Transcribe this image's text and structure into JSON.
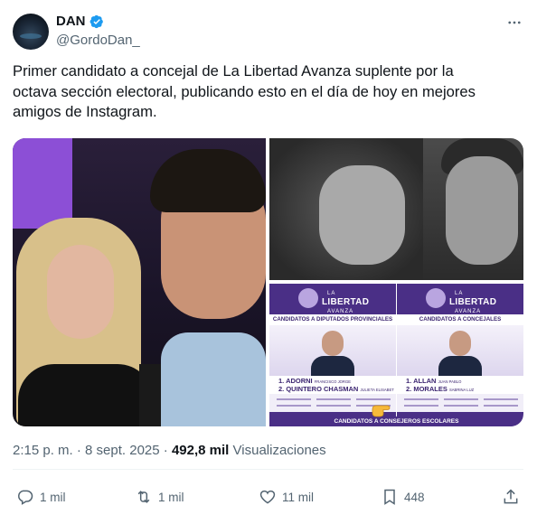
{
  "author": {
    "display_name": "DAN",
    "handle": "@GordoDan_",
    "verified": true
  },
  "tweet": {
    "text_lines": [
      "Primer candidato a concejal de La Libertad Avanza suplente por la",
      "octava sección electoral, publicando esto en el día de hoy en mejores",
      "amigos de Instagram."
    ]
  },
  "flyer": {
    "brand_line1": "LA",
    "brand_line2": "LIBERTAD",
    "brand_line3": "AVANZA",
    "left_title": "CANDIDATOS A DIPUTADOS PROVINCIALES",
    "right_title": "CANDIDATOS A CONCEJALES",
    "left_name1": "ADORNI",
    "left_name1_first": "FRANCISCO JORGE",
    "left_name2": "QUINTERO CHASMAN",
    "left_name2_first": "JULIETA ELISABET",
    "right_name1": "ALLAN",
    "right_name1_first": "JUAN PABLO",
    "right_name2": "MORALES",
    "right_name2_first": "SABRINA LUZ",
    "footer": "CANDIDATOS A CONSEJEROS ESCOLARES"
  },
  "meta": {
    "time": "2:15 p. m.",
    "separator": "·",
    "date": "8 sept. 2025",
    "views_count": "492,8 mil",
    "views_label": "Visualizaciones"
  },
  "actions": {
    "replies": "1 mil",
    "retweets": "1 mil",
    "likes": "11 mil",
    "bookmarks": "448"
  },
  "colors": {
    "verified_blue": "#1d9bf0",
    "text_primary": "#0f1419",
    "text_secondary": "#536471",
    "flyer_purple": "#4a2f86"
  }
}
